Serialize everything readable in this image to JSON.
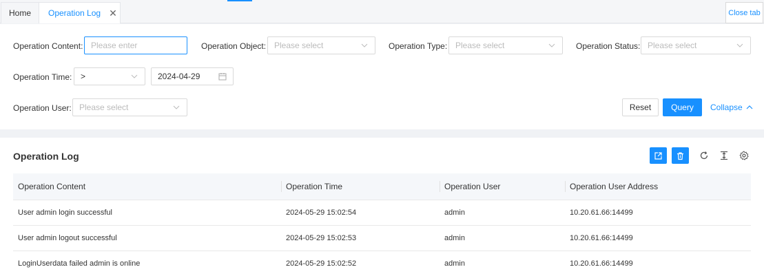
{
  "tabs": {
    "home_label": "Home",
    "active_label": "Operation Log",
    "close_tab_label": "Close tab"
  },
  "filters": {
    "content_label": "Operation Content:",
    "content_placeholder": "Please enter",
    "object_label": "Operation Object:",
    "object_placeholder": "Please select",
    "type_label": "Operation Type:",
    "type_placeholder": "Please select",
    "status_label": "Operation Status:",
    "status_placeholder": "Please select",
    "time_label": "Operation Time:",
    "time_operator": ">",
    "time_date": "2024-04-29",
    "user_label": "Operation User:",
    "user_placeholder": "Please select",
    "reset_label": "Reset",
    "query_label": "Query",
    "collapse_label": "Collapse"
  },
  "panel": {
    "title": "Operation Log",
    "columns": [
      "Operation Content",
      "Operation Time",
      "Operation User",
      "Operation User Address"
    ],
    "rows": [
      [
        "User admin login successful",
        "2024-05-29 15:02:54",
        "admin",
        "10.20.61.66:14499"
      ],
      [
        "User admin logout successful",
        "2024-05-29 15:02:53",
        "admin",
        "10.20.61.66:14499"
      ],
      [
        "LoginUserdata failed admin is online",
        "2024-05-29 15:02:52",
        "admin",
        "10.20.61.66:14499"
      ]
    ]
  },
  "colors": {
    "accent": "#1890ff",
    "background": "#f0f2f5"
  }
}
